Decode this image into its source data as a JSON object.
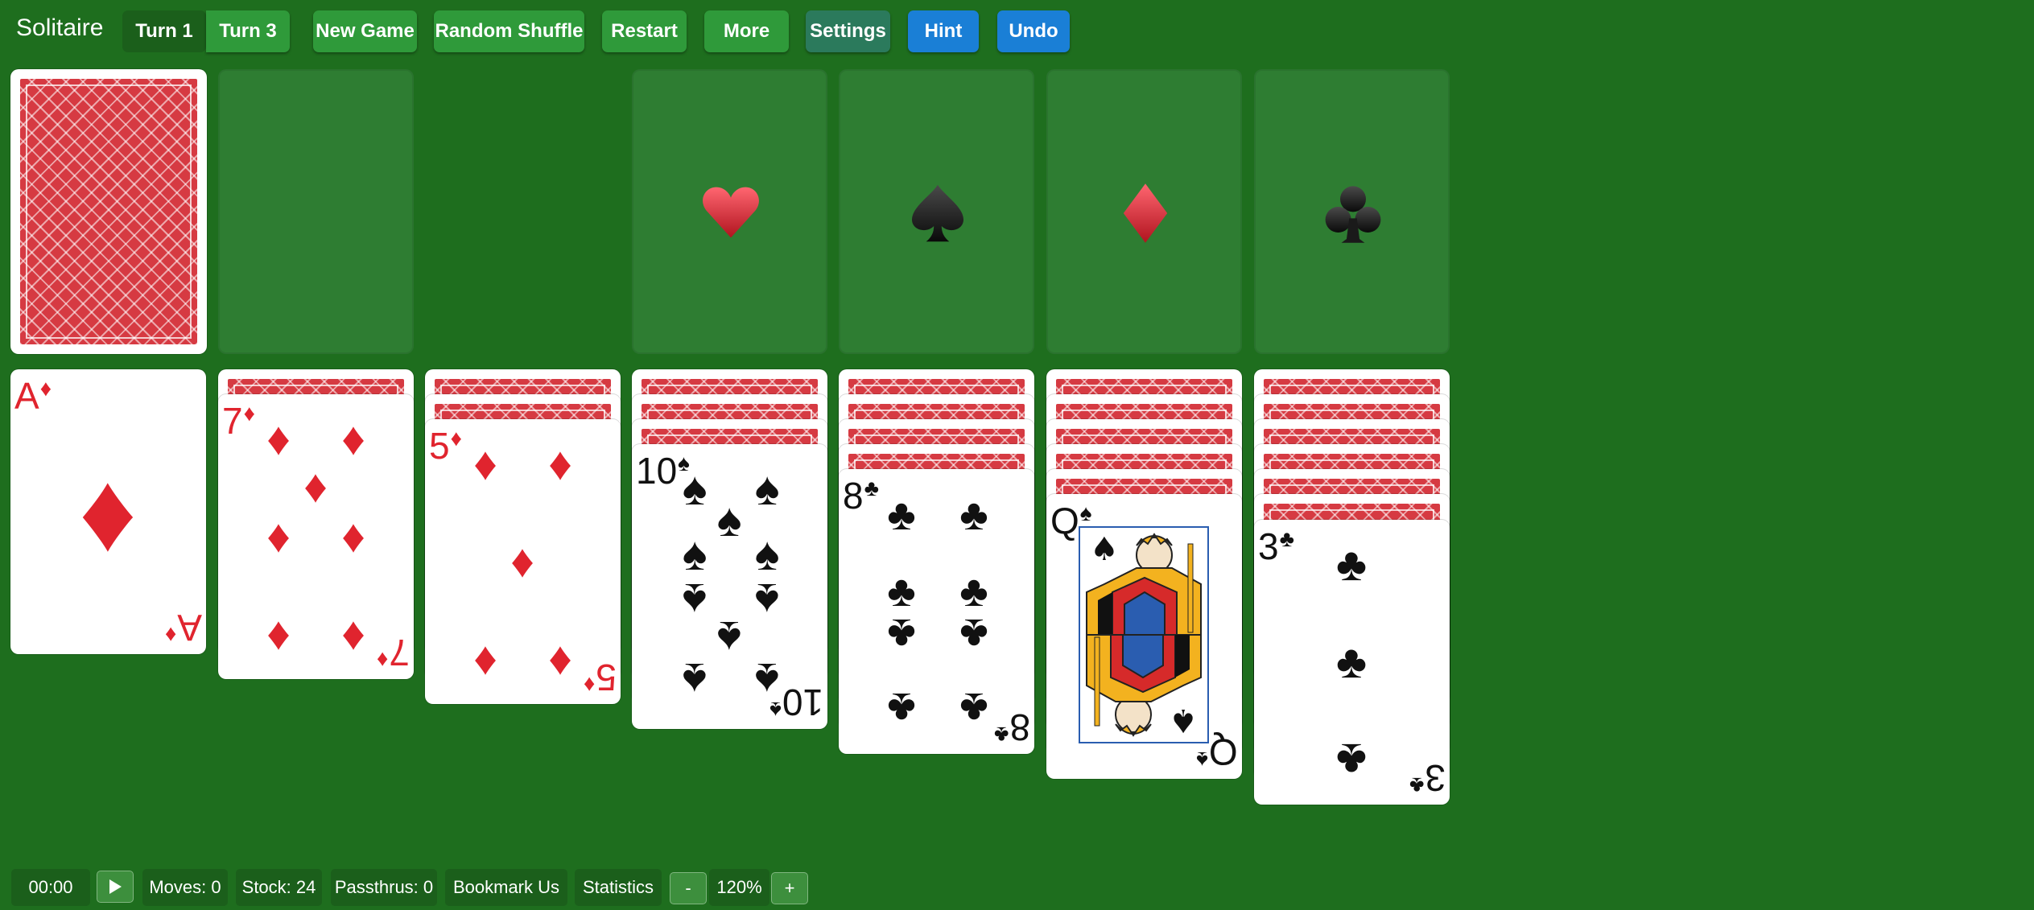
{
  "app": {
    "title": "Solitaire"
  },
  "toolbar": {
    "turn1": "Turn 1",
    "turn3": "Turn 3",
    "new_game": "New Game",
    "random_shuffle": "Random Shuffle",
    "restart": "Restart",
    "more": "More",
    "settings": "Settings",
    "hint": "Hint",
    "undo": "Undo"
  },
  "foundations": [
    {
      "suit": "hearts",
      "symbol": "♥",
      "color": "#d42a35"
    },
    {
      "suit": "spades",
      "symbol": "♠",
      "color": "#111111"
    },
    {
      "suit": "diamonds",
      "symbol": "♦",
      "color": "#d42a35"
    },
    {
      "suit": "clubs",
      "symbol": "♣",
      "color": "#111111"
    }
  ],
  "stock": {
    "face_down": true
  },
  "tableau": [
    {
      "face_down": 0,
      "card": {
        "rank": "A",
        "suit": "♦",
        "color": "red"
      }
    },
    {
      "face_down": 1,
      "card": {
        "rank": "7",
        "suit": "♦",
        "color": "red"
      }
    },
    {
      "face_down": 2,
      "card": {
        "rank": "5",
        "suit": "♦",
        "color": "red"
      }
    },
    {
      "face_down": 3,
      "card": {
        "rank": "10",
        "suit": "♠",
        "color": "black"
      }
    },
    {
      "face_down": 4,
      "card": {
        "rank": "8",
        "suit": "♣",
        "color": "black"
      }
    },
    {
      "face_down": 5,
      "card": {
        "rank": "Q",
        "suit": "♠",
        "color": "black"
      }
    },
    {
      "face_down": 6,
      "card": {
        "rank": "3",
        "suit": "♣",
        "color": "black"
      }
    }
  ],
  "status": {
    "timer": "00:00",
    "play_icon": "play-icon",
    "moves": "Moves: 0",
    "stock": "Stock: 24",
    "passthrus": "Passthrus: 0",
    "bookmark": "Bookmark Us",
    "statistics": "Statistics",
    "zoom_out": "-",
    "zoom": "120%",
    "zoom_in": "+"
  },
  "colors": {
    "table": "#1e6e1e",
    "slot": "#2e7d32",
    "button_green": "#2f9a3a",
    "button_blue": "#1a7fd6",
    "card_red": "#e0242e",
    "card_back": "#d63a42"
  }
}
